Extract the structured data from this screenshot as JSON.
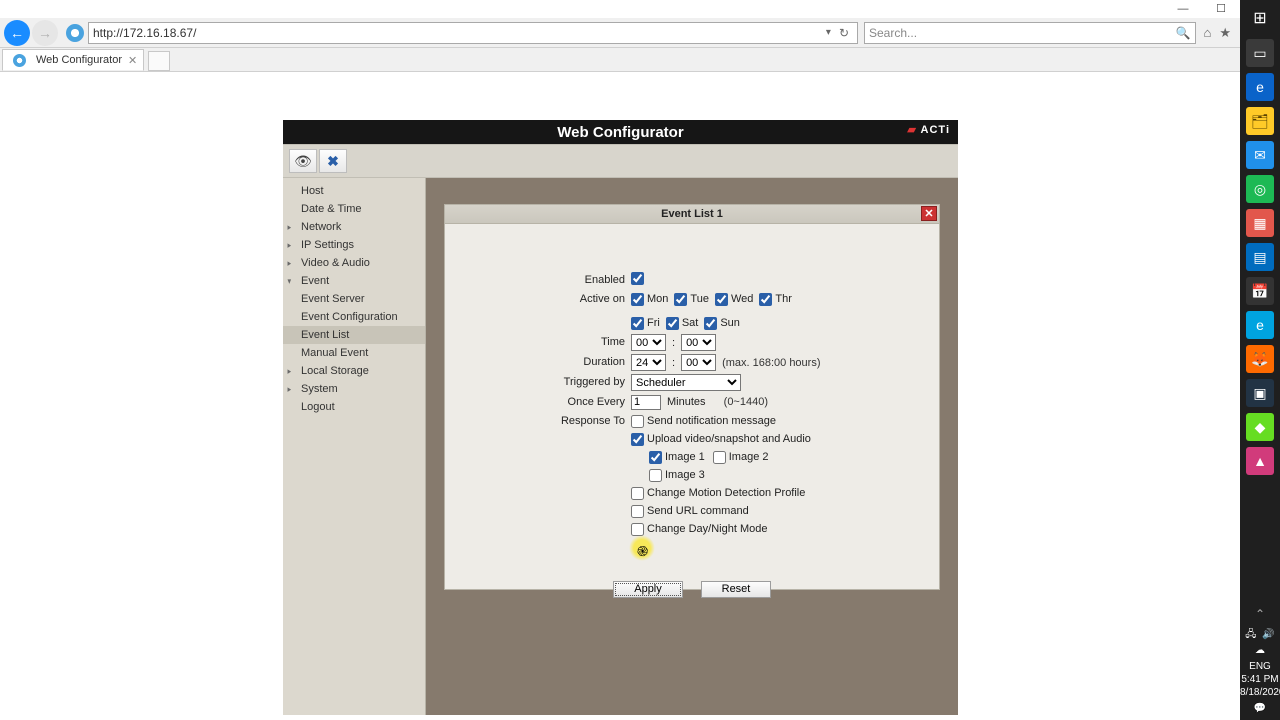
{
  "browser": {
    "url": "http://172.16.18.67/",
    "search_placeholder": "Search...",
    "tab_title": "Web Configurator"
  },
  "app": {
    "title": "Web Configurator",
    "logo_text": "ACTi"
  },
  "sidebar": {
    "items": [
      {
        "label": "Host",
        "children": false
      },
      {
        "label": "Date & Time",
        "children": false
      },
      {
        "label": "Network",
        "children": true
      },
      {
        "label": "IP Settings",
        "children": true
      },
      {
        "label": "Video & Audio",
        "children": true
      },
      {
        "label": "Event",
        "children": true,
        "expanded": true
      },
      {
        "label": "Event Server",
        "children": false,
        "indent": true
      },
      {
        "label": "Event Configuration",
        "children": false,
        "indent": true
      },
      {
        "label": "Event List",
        "children": false,
        "indent": true,
        "selected": true
      },
      {
        "label": "Manual Event",
        "children": false,
        "indent": true
      },
      {
        "label": "Local Storage",
        "children": true
      },
      {
        "label": "System",
        "children": true
      },
      {
        "label": "Logout",
        "children": false
      }
    ]
  },
  "card": {
    "title": "Event List   1",
    "labels": {
      "enabled": "Enabled",
      "activeon": "Active on",
      "time": "Time",
      "duration": "Duration",
      "triggeredby": "Triggered by",
      "onceevery": "Once Every",
      "responseto": "Response To"
    },
    "days": {
      "mon": "Mon",
      "tue": "Tue",
      "wed": "Wed",
      "thr": "Thr",
      "fri": "Fri",
      "sat": "Sat",
      "sun": "Sun"
    },
    "time_hh": "00",
    "time_mm": "00",
    "dur_hh": "24",
    "dur_mm": "00",
    "dur_note": "(max. 168:00 hours)",
    "trigger_value": "Scheduler",
    "onceevery_value": "1",
    "onceevery_unit": "Minutes",
    "onceevery_range": "(0~1440)",
    "responses": {
      "notify": "Send notification message",
      "upload": "Upload video/snapshot and Audio",
      "img1": "Image 1",
      "img2": "Image 2",
      "img3": "Image 3",
      "motion": "Change Motion Detection Profile",
      "url": "Send URL command",
      "daynight": "Change Day/Night Mode"
    },
    "apply": "Apply",
    "reset": "Reset"
  },
  "tray": {
    "lang": "ENG",
    "time": "5:41 PM",
    "date": "8/18/2020"
  }
}
